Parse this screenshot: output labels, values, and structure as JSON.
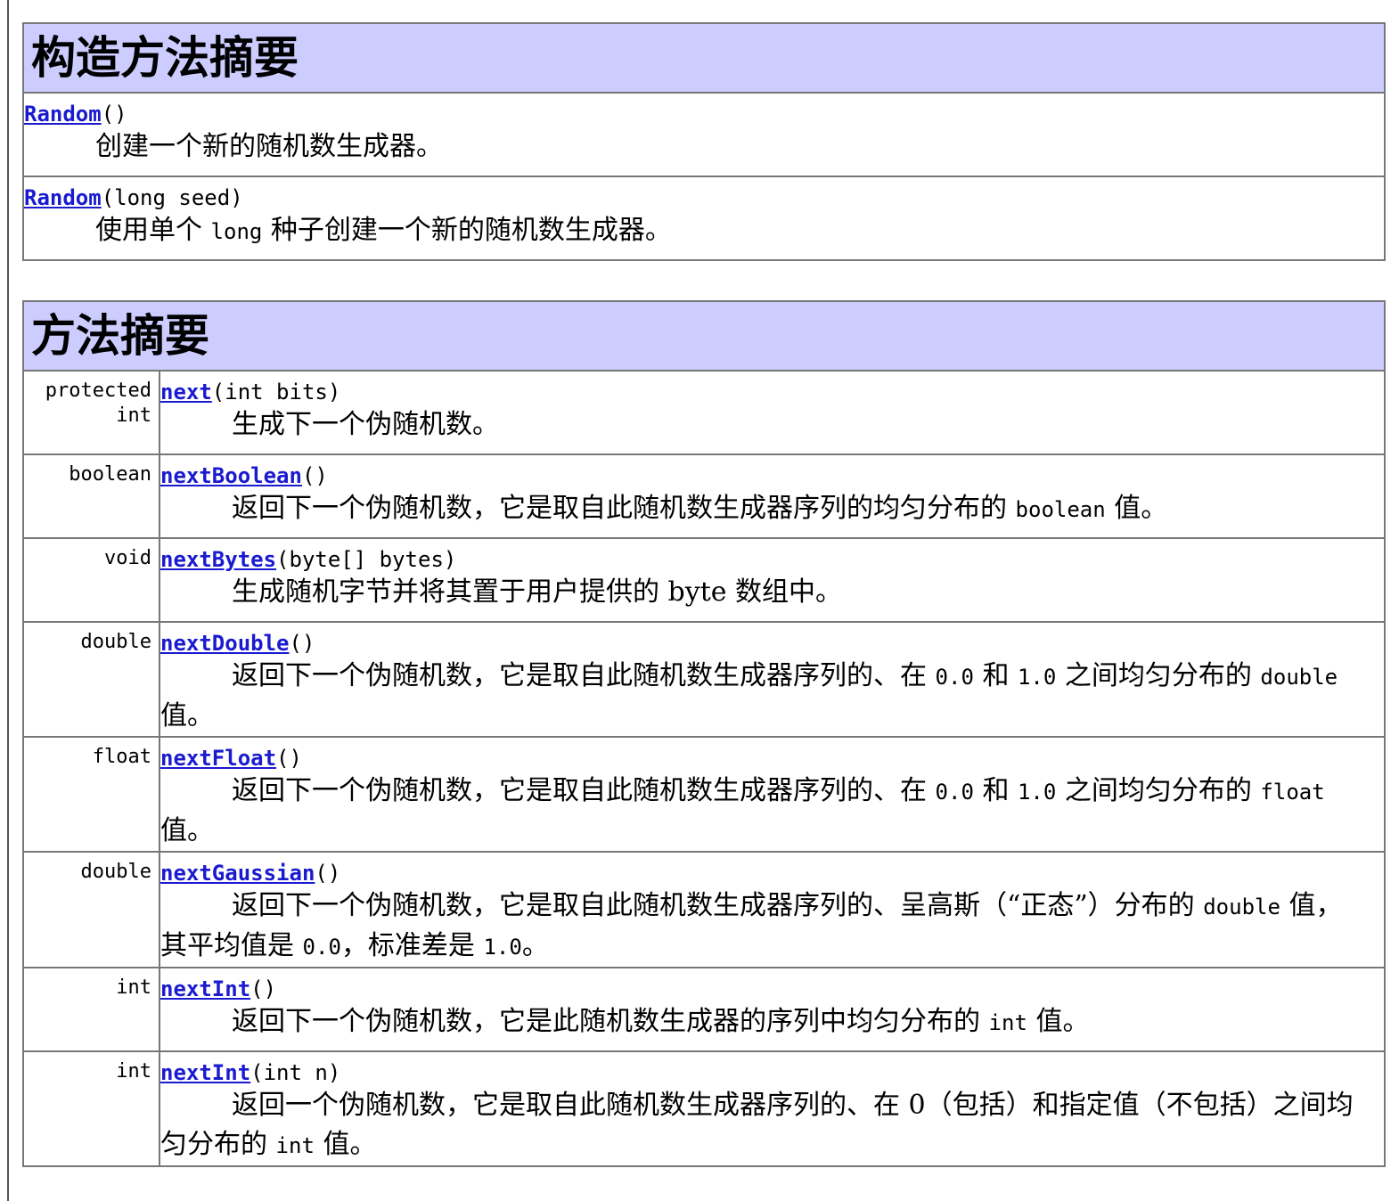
{
  "constructor_summary": {
    "title": "构造方法摘要",
    "rows": [
      {
        "name": "Random",
        "params": "()",
        "desc": [
          "创建一个新的随机数生成器。"
        ]
      },
      {
        "name": "Random",
        "params": "(long seed)",
        "desc": [
          "使用单个 ",
          {
            "code": "long"
          },
          " 种子创建一个新的随机数生成器。"
        ]
      }
    ]
  },
  "method_summary": {
    "title": "方法摘要",
    "rows": [
      {
        "type": "protected int",
        "name": "next",
        "params": "(int bits)",
        "desc": [
          "生成下一个伪随机数。"
        ]
      },
      {
        "type": "boolean",
        "name": "nextBoolean",
        "params": "()",
        "desc": [
          "返回下一个伪随机数，它是取自此随机数生成器序列的均匀分布的 ",
          {
            "code": "boolean"
          },
          " 值。"
        ]
      },
      {
        "type": "void",
        "name": "nextBytes",
        "params": "(byte[] bytes)",
        "desc": [
          "生成随机字节并将其置于用户提供的 byte 数组中。"
        ]
      },
      {
        "type": "double",
        "name": "nextDouble",
        "params": "()",
        "desc": [
          "返回下一个伪随机数，它是取自此随机数生成器序列的、在 ",
          {
            "code": "0.0"
          },
          " 和 ",
          {
            "code": "1.0"
          },
          " 之间均匀分布的 ",
          {
            "code": "double"
          },
          " 值。"
        ]
      },
      {
        "type": "float",
        "name": "nextFloat",
        "params": "()",
        "desc": [
          "返回下一个伪随机数，它是取自此随机数生成器序列的、在 ",
          {
            "code": "0.0"
          },
          " 和 ",
          {
            "code": "1.0"
          },
          " 之间均匀分布的 ",
          {
            "code": "float"
          },
          " 值。"
        ]
      },
      {
        "type": "double",
        "name": "nextGaussian",
        "params": "()",
        "desc": [
          "返回下一个伪随机数，它是取自此随机数生成器序列的、呈高斯（“正态”）分布的 ",
          {
            "code": "double"
          },
          " 值，其平均值是 ",
          {
            "code": "0.0"
          },
          "，标准差是 ",
          {
            "code": "1.0"
          },
          "。"
        ]
      },
      {
        "type": "int",
        "name": "nextInt",
        "params": "()",
        "desc": [
          "返回下一个伪随机数，它是此随机数生成器的序列中均匀分布的 ",
          {
            "code": "int"
          },
          " 值。"
        ]
      },
      {
        "type": "int",
        "name": "nextInt",
        "params": "(int n)",
        "desc": [
          "返回一个伪随机数，它是取自此随机数生成器序列的、在 0（包括）和指定值（不包括）之间均匀分布的 ",
          {
            "code": "int"
          },
          " 值。"
        ]
      }
    ]
  }
}
